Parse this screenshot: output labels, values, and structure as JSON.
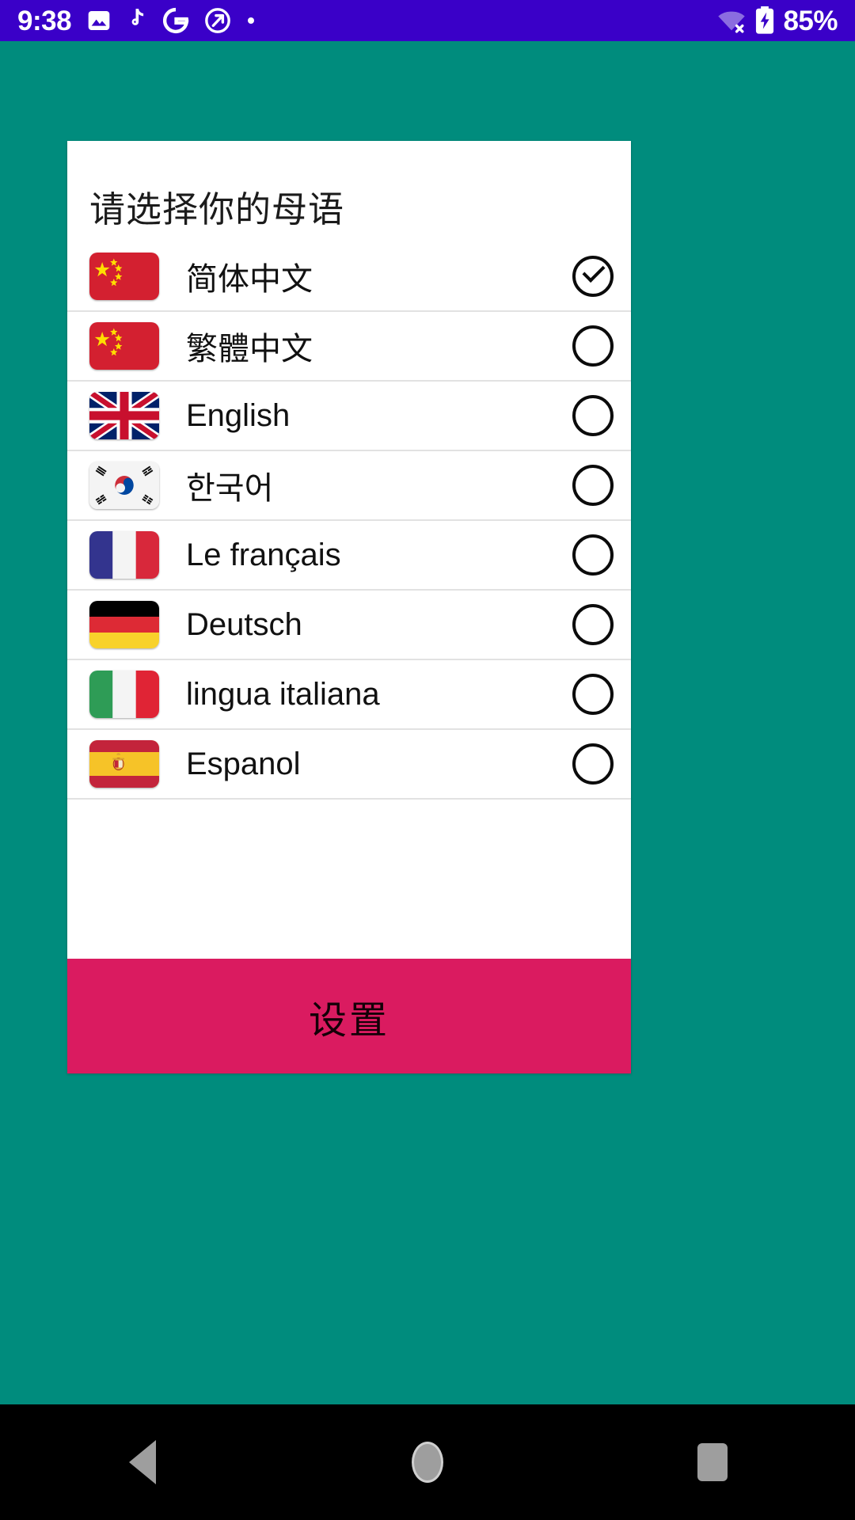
{
  "status_bar": {
    "time": "9:38",
    "battery_percent": "85%",
    "background_color": "#3a00c8",
    "left_icons": [
      {
        "name": "photo-gallery-icon"
      },
      {
        "name": "tiktok-music-note-icon"
      },
      {
        "name": "google-g-icon"
      },
      {
        "name": "circle-arrow-icon"
      },
      {
        "name": "dot-icon"
      }
    ],
    "right_icons": [
      {
        "name": "wifi-disconnected-icon"
      },
      {
        "name": "battery-charging-icon"
      }
    ]
  },
  "background": {
    "color": "#008c7d"
  },
  "dialog": {
    "title": "请选择你的母语",
    "background_color": "#ffffff",
    "languages": [
      {
        "label": "简体中文",
        "flag": "china-flag",
        "selected": true
      },
      {
        "label": "繁體中文",
        "flag": "china-flag",
        "selected": false
      },
      {
        "label": "English",
        "flag": "united-kingdom-flag",
        "selected": false
      },
      {
        "label": "한국어",
        "flag": "south-korea-flag",
        "selected": false
      },
      {
        "label": "Le français",
        "flag": "france-flag",
        "selected": false
      },
      {
        "label": "Deutsch",
        "flag": "germany-flag",
        "selected": false
      },
      {
        "label": "lingua italiana",
        "flag": "italy-flag",
        "selected": false
      },
      {
        "label": "Espanol",
        "flag": "spain-flag",
        "selected": false
      }
    ]
  },
  "confirm_button": {
    "label": "设置",
    "background_color": "#da1b60",
    "text_color": "#140007"
  },
  "nav_bar": {
    "background_color": "#000000",
    "buttons": [
      {
        "name": "back-button"
      },
      {
        "name": "home-button"
      },
      {
        "name": "recents-button"
      }
    ]
  }
}
